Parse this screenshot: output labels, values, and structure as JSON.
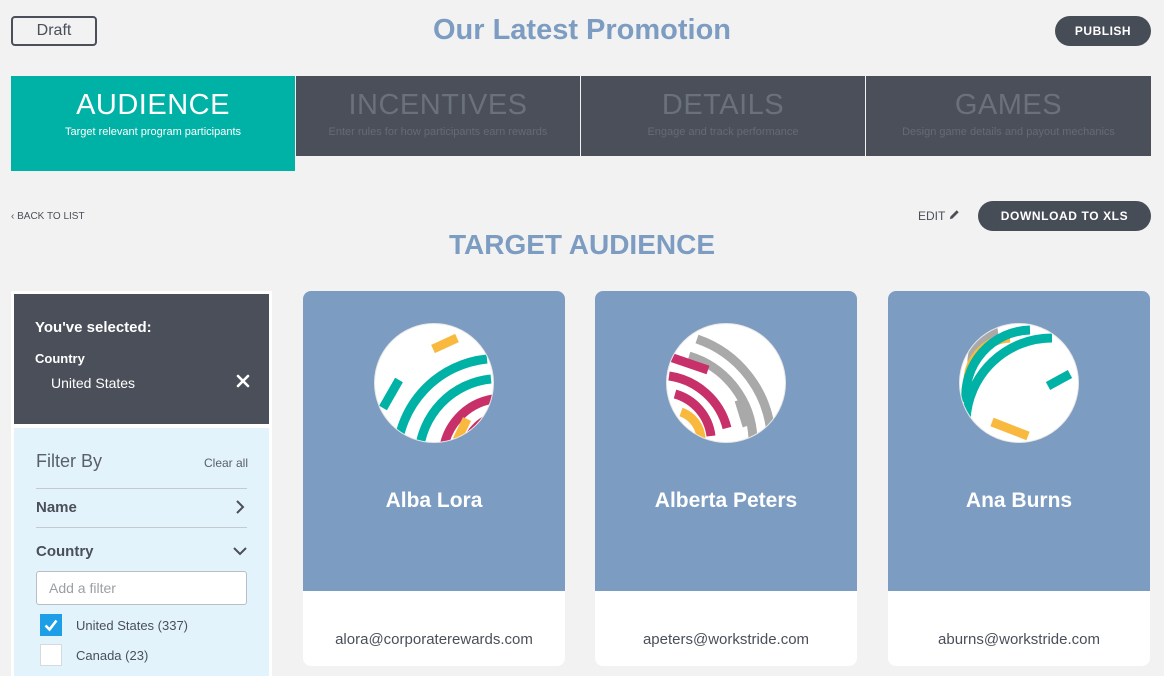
{
  "header": {
    "status_badge": "Draft",
    "title": "Our Latest Promotion",
    "publish_label": "PUBLISH"
  },
  "tabs": [
    {
      "title": "AUDIENCE",
      "subtitle": "Target relevant program participants",
      "active": true
    },
    {
      "title": "INCENTIVES",
      "subtitle": "Enter rules for how participants earn rewards",
      "active": false
    },
    {
      "title": "DETAILS",
      "subtitle": "Engage and track performance",
      "active": false
    },
    {
      "title": "GAMES",
      "subtitle": "Design game details and payout mechanics",
      "active": false
    }
  ],
  "toolbar": {
    "back_label": "BACK TO LIST",
    "edit_label": "EDIT",
    "download_label": "DOWNLOAD TO XLS"
  },
  "section_title": "TARGET AUDIENCE",
  "selection": {
    "title": "You've selected:",
    "category": "Country",
    "value": "United States"
  },
  "filters": {
    "title": "Filter By",
    "clear_label": "Clear all",
    "groups": [
      {
        "label": "Name",
        "expanded": false
      },
      {
        "label": "Country",
        "expanded": true
      }
    ],
    "input_placeholder": "Add a filter",
    "options": [
      {
        "label": "United States (337)",
        "checked": true
      },
      {
        "label": "Canada (23)",
        "checked": false
      }
    ]
  },
  "participants": [
    {
      "name": "Alba Lora",
      "email": "alora@corporaterewards.com"
    },
    {
      "name": "Alberta Peters",
      "email": "apeters@workstride.com"
    },
    {
      "name": "Ana Burns",
      "email": "aburns@workstride.com"
    }
  ],
  "colors": {
    "accent": "#00b2a6",
    "dark": "#4a4f59",
    "title_blue": "#7d9cc1",
    "card_blue": "#7d9cc1",
    "check_blue": "#1e9ee6",
    "avatar_teal": "#00b2a6",
    "avatar_yellow": "#f9b93f",
    "avatar_magenta": "#c8306a",
    "avatar_gray": "#a9a9a9"
  },
  "icons": {
    "back": "chevron-left-icon",
    "edit": "pencil-icon",
    "remove": "close-icon",
    "collapsed": "chevron-right-icon",
    "expanded": "chevron-down-icon",
    "checked": "checkmark-icon"
  }
}
